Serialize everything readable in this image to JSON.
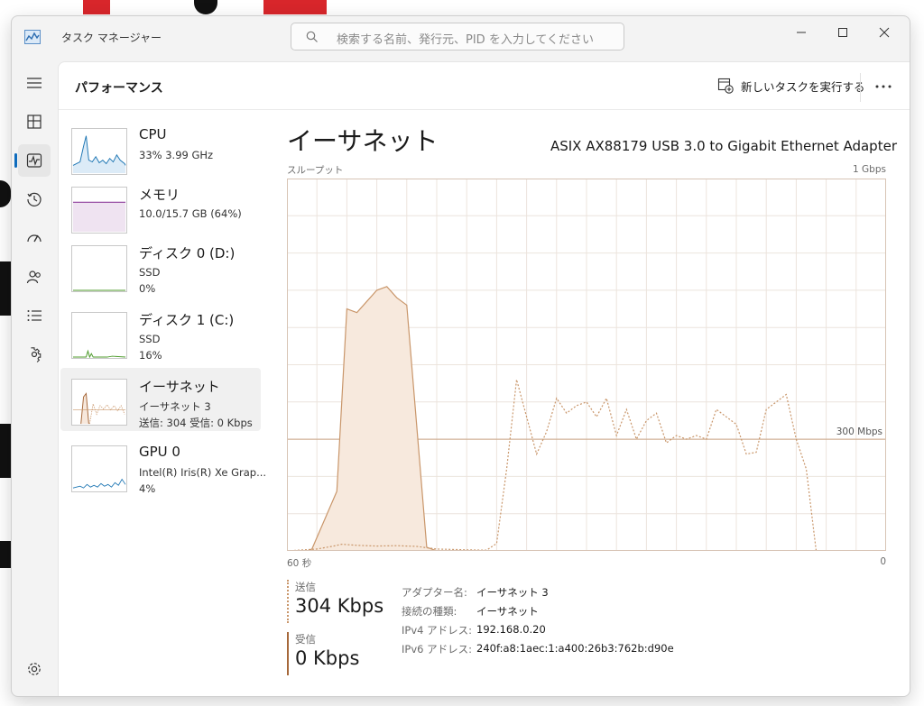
{
  "window": {
    "title": "タスク マネージャー"
  },
  "search": {
    "placeholder": "検索する名前、発行元、PID を入力してください"
  },
  "header": {
    "page_title": "パフォーマンス",
    "run_task_label": "新しいタスクを実行する"
  },
  "nav": {
    "items": [
      {
        "name": "menu",
        "icon": "hamburger-icon"
      },
      {
        "name": "processes",
        "icon": "processes-icon"
      },
      {
        "name": "performance",
        "icon": "performance-icon",
        "active": true
      },
      {
        "name": "app-history",
        "icon": "history-icon"
      },
      {
        "name": "startup",
        "icon": "startup-icon"
      },
      {
        "name": "users",
        "icon": "users-icon"
      },
      {
        "name": "details",
        "icon": "details-icon"
      },
      {
        "name": "services",
        "icon": "services-icon"
      }
    ],
    "settings_icon": "gear-icon"
  },
  "perf_items": [
    {
      "name": "CPU",
      "line1": "33%  3.99 GHz",
      "line2": "",
      "color": "#1f77b4"
    },
    {
      "name": "メモリ",
      "line1": "10.0/15.7 GB (64%)",
      "line2": "",
      "color": "#8e3e9a"
    },
    {
      "name": "ディスク 0 (D:)",
      "line1": "SSD",
      "line2": "0%",
      "color": "#4c9a2a"
    },
    {
      "name": "ディスク 1 (C:)",
      "line1": "SSD",
      "line2": "16%",
      "color": "#4c9a2a"
    },
    {
      "name": "イーサネット",
      "line1": "イーサネット 3",
      "line2": "送信: 304  受信: 0 Kbps",
      "color": "#a6683a",
      "selected": true
    },
    {
      "name": "GPU 0",
      "line1": "Intel(R) Iris(R) Xe Grap...",
      "line2": "4%",
      "color": "#1f77b4"
    }
  ],
  "detail": {
    "title": "イーサネット",
    "adapter": "ASIX AX88179 USB 3.0 to Gigabit Ethernet Adapter",
    "chart_label_tl": "スループット",
    "chart_label_tr": "1 Gbps",
    "chart_label_bl": "60 秒",
    "chart_label_br": "0",
    "ref_line_label": "300 Mbps"
  },
  "stats": {
    "send_label": "送信",
    "send_value": "304 Kbps",
    "recv_label": "受信",
    "recv_value": "0 Kbps"
  },
  "properties": [
    {
      "key": "アダプター名:",
      "value": "イーサネット 3"
    },
    {
      "key": "接続の種類:",
      "value": "イーサネット"
    },
    {
      "key": "IPv4 アドレス:",
      "value": "192.168.0.20"
    },
    {
      "key": "IPv6 アドレス:",
      "value": "240f:a8:1aec:1:a400:26b3:762b:d90e"
    }
  ],
  "chart_data": {
    "type": "area",
    "x_range_seconds": [
      60,
      0
    ],
    "y_range_mbps": [
      0,
      1000
    ],
    "grid": true,
    "reference_line_mbps": 300,
    "series": [
      {
        "name": "受信",
        "style": "filled area, solid line",
        "color": "#c9966a",
        "points": [
          [
            60,
            0
          ],
          [
            58,
            0
          ],
          [
            57.5,
            5
          ],
          [
            55,
            160
          ],
          [
            54,
            650
          ],
          [
            53,
            640
          ],
          [
            52,
            670
          ],
          [
            51,
            700
          ],
          [
            50,
            710
          ],
          [
            49,
            680
          ],
          [
            48,
            660
          ],
          [
            46,
            10
          ],
          [
            45,
            0
          ],
          [
            40,
            0
          ],
          [
            0,
            0
          ]
        ]
      },
      {
        "name": "送信",
        "style": "dotted line",
        "color": "#c9966a",
        "points": [
          [
            60,
            0
          ],
          [
            57,
            5
          ],
          [
            55.5,
            12
          ],
          [
            54.5,
            18
          ],
          [
            53,
            15
          ],
          [
            51,
            13
          ],
          [
            49,
            14
          ],
          [
            47,
            12
          ],
          [
            45,
            5
          ],
          [
            42,
            3
          ],
          [
            40,
            2
          ],
          [
            39,
            20
          ],
          [
            38,
            220
          ],
          [
            37,
            460
          ],
          [
            35,
            260
          ],
          [
            34,
            320
          ],
          [
            33,
            410
          ],
          [
            32,
            370
          ],
          [
            31,
            390
          ],
          [
            30,
            400
          ],
          [
            29,
            360
          ],
          [
            28,
            410
          ],
          [
            27,
            310
          ],
          [
            26,
            380
          ],
          [
            25,
            300
          ],
          [
            24,
            350
          ],
          [
            23,
            370
          ],
          [
            22,
            290
          ],
          [
            21,
            310
          ],
          [
            20,
            300
          ],
          [
            19,
            310
          ],
          [
            18,
            300
          ],
          [
            17,
            380
          ],
          [
            16,
            360
          ],
          [
            15,
            340
          ],
          [
            14,
            260
          ],
          [
            13,
            265
          ],
          [
            12,
            380
          ],
          [
            11,
            400
          ],
          [
            10,
            420
          ],
          [
            9,
            300
          ],
          [
            8,
            220
          ],
          [
            7,
            0
          ],
          [
            0,
            0
          ]
        ]
      }
    ]
  }
}
